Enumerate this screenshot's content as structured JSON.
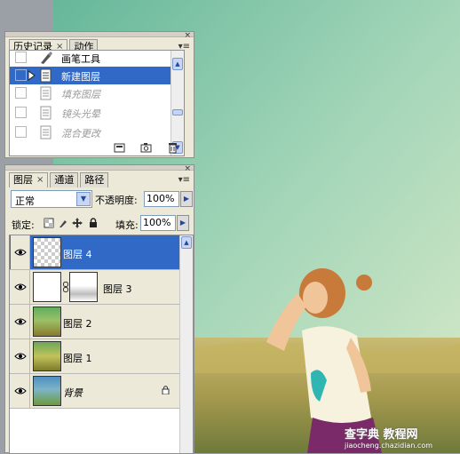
{
  "history_panel": {
    "tabs": [
      {
        "label": "历史记录",
        "close": "×",
        "active": true
      },
      {
        "label": "动作",
        "active": false
      }
    ],
    "close_glyph": "×",
    "menu_glyph": "▾≡",
    "items": [
      {
        "label": "画笔工具",
        "icon": "brush-icon",
        "state": "normal"
      },
      {
        "label": "新建图层",
        "icon": "document-icon",
        "state": "selected"
      },
      {
        "label": "填充图层",
        "icon": "document-icon",
        "state": "disabled"
      },
      {
        "label": "镜头光晕",
        "icon": "document-icon",
        "state": "disabled"
      },
      {
        "label": "混合更改",
        "icon": "document-icon",
        "state": "disabled"
      }
    ],
    "footer_icons": [
      "new-document-from-state-icon",
      "new-snapshot-icon",
      "trash-icon"
    ]
  },
  "layers_panel": {
    "tabs": [
      {
        "label": "图层",
        "close": "×",
        "active": true
      },
      {
        "label": "通道",
        "active": false
      },
      {
        "label": "路径",
        "active": false
      }
    ],
    "close_glyph": "×",
    "menu_glyph": "▾≡",
    "blend_mode": "正常",
    "opacity_label": "不透明度:",
    "opacity_value": "100%",
    "lock_label": "锁定:",
    "fill_label": "填充:",
    "fill_value": "100%",
    "layers": [
      {
        "name": "图层 4",
        "thumb": "transparent",
        "visible": true,
        "selected": true
      },
      {
        "name": "图层 3",
        "thumb": "mask",
        "visible": true,
        "selected": false
      },
      {
        "name": "图层 2",
        "thumb": "photo",
        "visible": true,
        "selected": false
      },
      {
        "name": "图层 1",
        "thumb": "photo",
        "visible": true,
        "selected": false
      },
      {
        "name": "背景",
        "thumb": "photo",
        "visible": true,
        "selected": false,
        "italic": true,
        "locked": true
      }
    ]
  },
  "watermark": {
    "line1": "查字典 教程网",
    "line2": "jiaocheng.chazidian.com"
  },
  "colors": {
    "selection": "#3169c6",
    "panel_bg": "#ece9d8",
    "sky": "#a9d3b6",
    "grass": "#b9a65a"
  }
}
